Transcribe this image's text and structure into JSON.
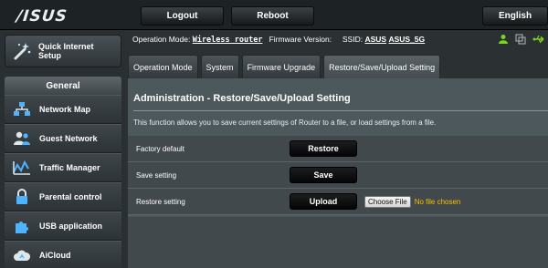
{
  "brand": {
    "logo_text": "/ISUS"
  },
  "topbar": {
    "logout": "Logout",
    "reboot": "Reboot",
    "language": "English"
  },
  "sidebar": {
    "quick_setup": "Quick Internet\nSetup",
    "section": "General",
    "items": [
      {
        "label": "Network Map",
        "icon": "network-map-icon"
      },
      {
        "label": "Guest Network",
        "icon": "guest-network-icon"
      },
      {
        "label": "Traffic Manager",
        "icon": "traffic-manager-icon"
      },
      {
        "label": "Parental control",
        "icon": "lock-icon"
      },
      {
        "label": "USB application",
        "icon": "puzzle-icon"
      },
      {
        "label": "AiCloud",
        "icon": "cloud-icon"
      }
    ]
  },
  "status": {
    "mode_label": "Operation Mode:",
    "mode_value": "Wireless router",
    "fw_label": "Firmware Version:",
    "ssid_label": "SSID:",
    "ssid_1": "ASUS",
    "ssid_2": "ASUS_5G"
  },
  "tabs": [
    {
      "label": "Operation Mode",
      "active": false
    },
    {
      "label": "System",
      "active": false
    },
    {
      "label": "Firmware Upgrade",
      "active": false
    },
    {
      "label": "Restore/Save/Upload Setting",
      "active": true
    }
  ],
  "main": {
    "title": "Administration - Restore/Save/Upload Setting",
    "description": "This function allows you to save current settings of Router to a file, or load settings from a file.",
    "rows": [
      {
        "label": "Factory default",
        "button": "Restore"
      },
      {
        "label": "Save setting",
        "button": "Save"
      },
      {
        "label": "Restore setting",
        "button": "Upload",
        "choose_file": "Choose File",
        "no_file": "No file chosen"
      }
    ]
  },
  "colors": {
    "accent_green": "#7ed321",
    "no_file_yellow": "#f2c200",
    "panel": "#4d585d"
  }
}
